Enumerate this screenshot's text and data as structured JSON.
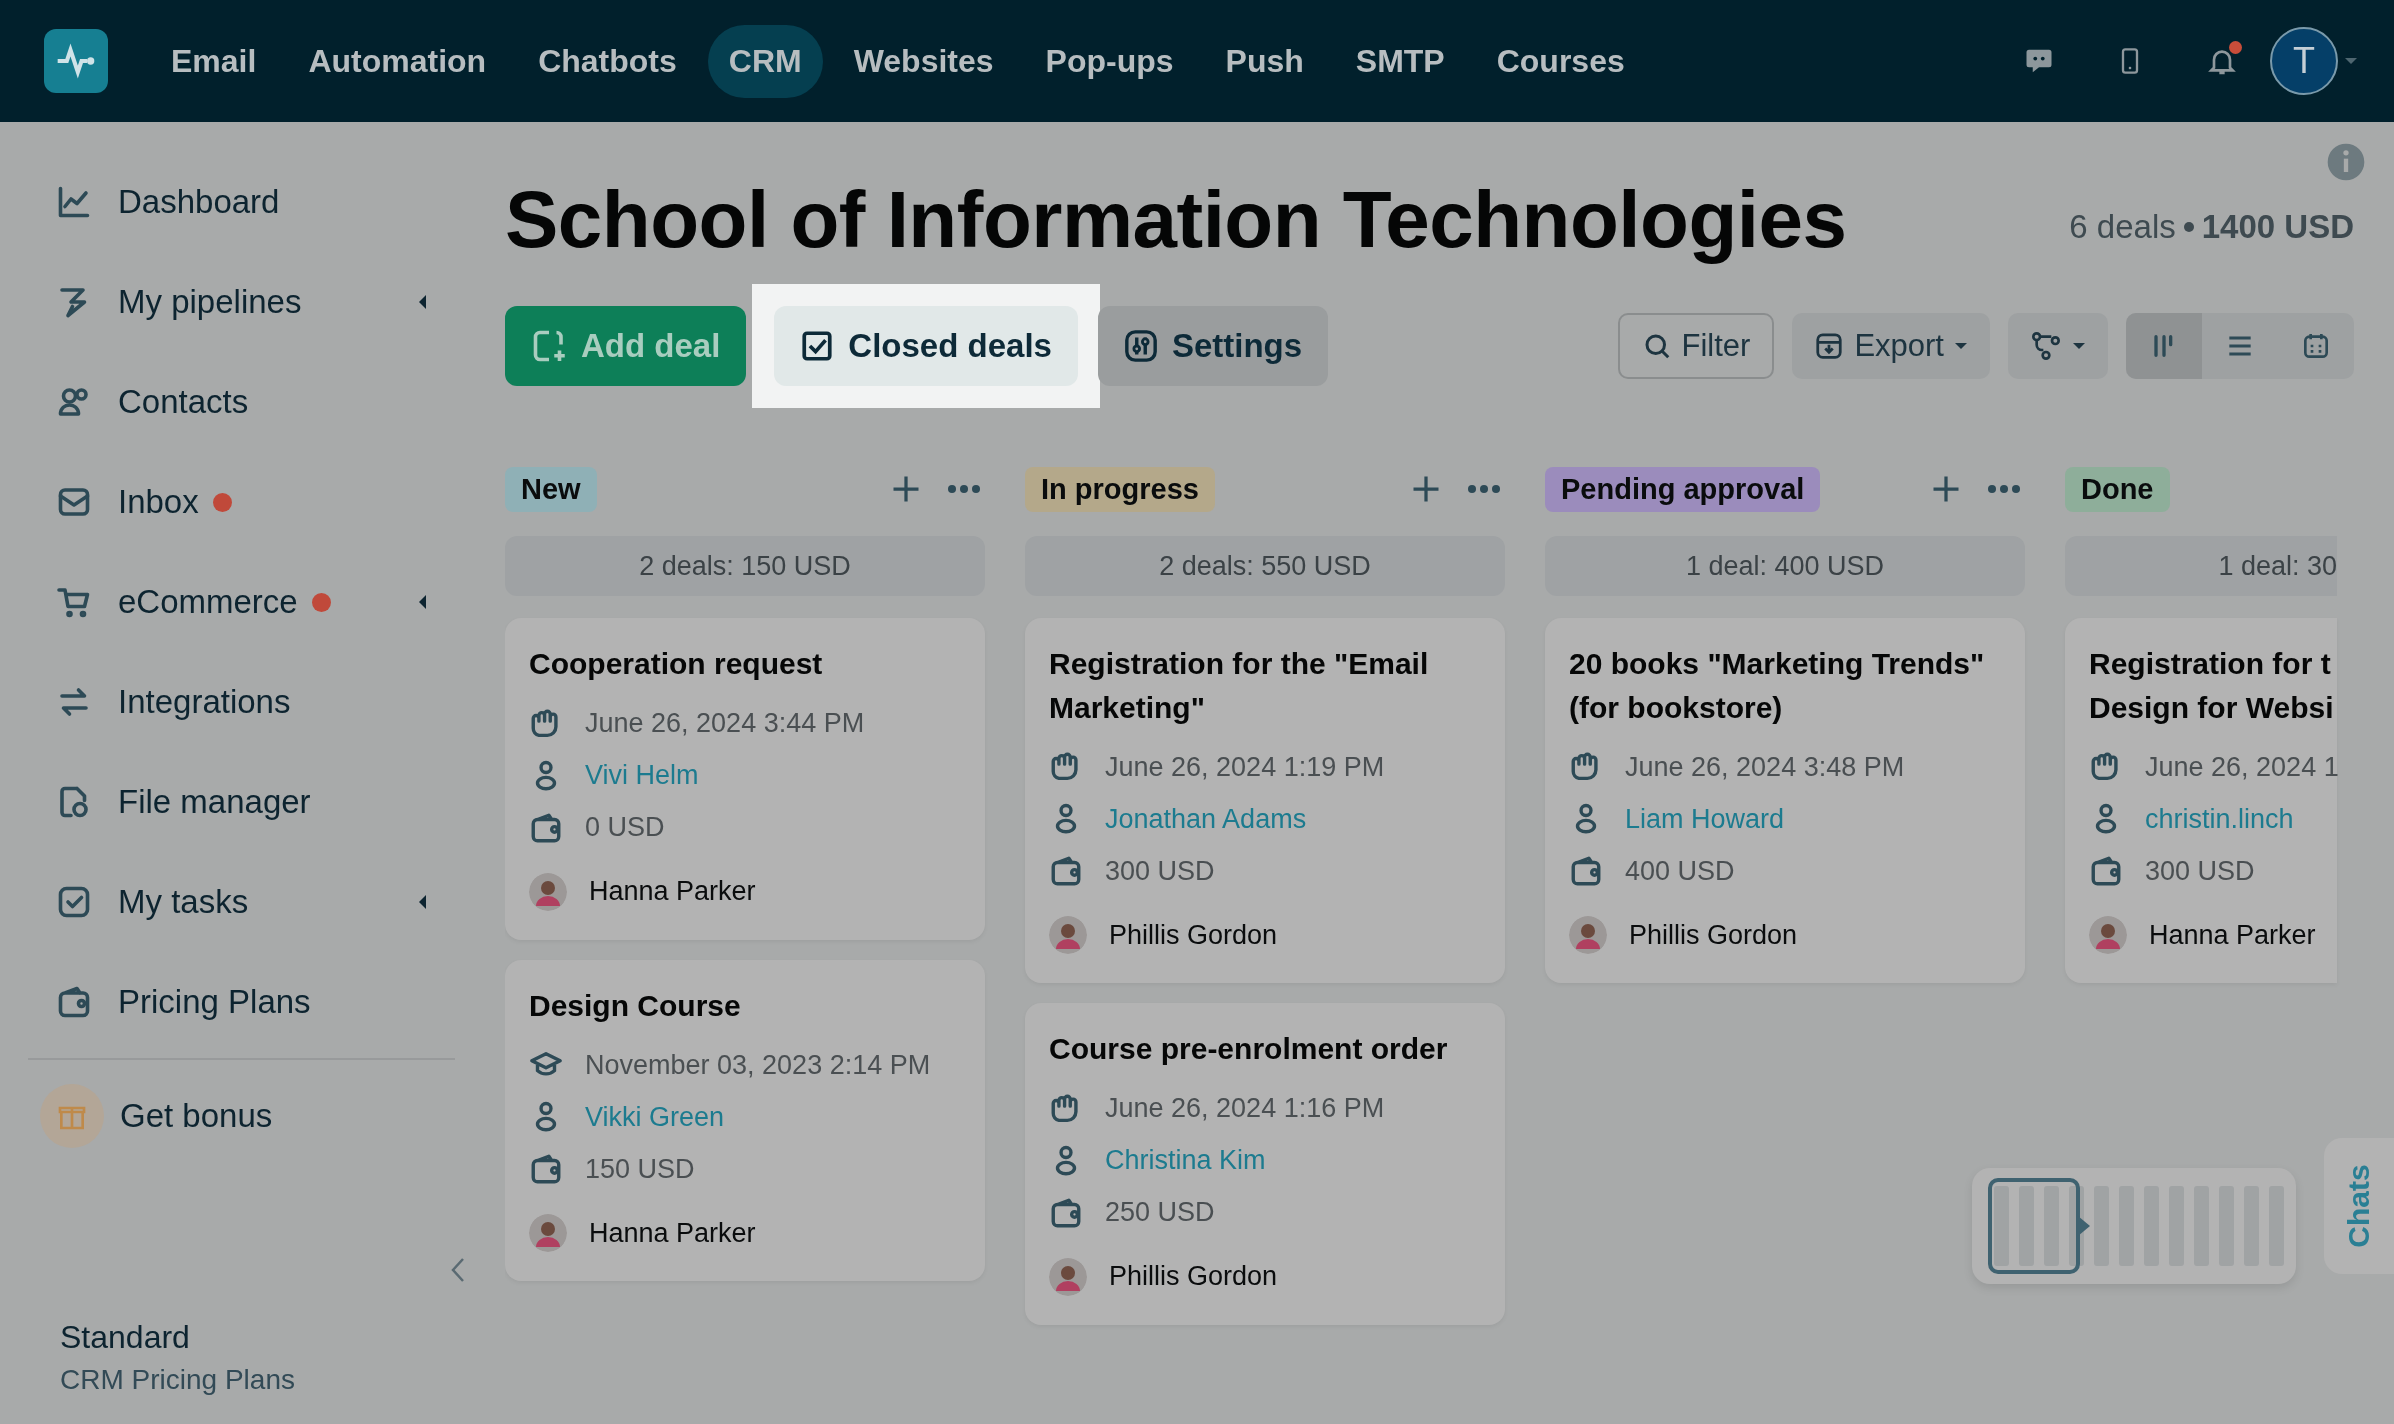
{
  "nav": {
    "items": [
      {
        "label": "Email",
        "selected": false
      },
      {
        "label": "Automation",
        "selected": false
      },
      {
        "label": "Chatbots",
        "selected": false
      },
      {
        "label": "CRM",
        "selected": true
      },
      {
        "label": "Websites",
        "selected": false
      },
      {
        "label": "Pop-ups",
        "selected": false
      },
      {
        "label": "Push",
        "selected": false
      },
      {
        "label": "SMTP",
        "selected": false
      },
      {
        "label": "Courses",
        "selected": false
      }
    ],
    "notifications_unread": true,
    "user_initial": "T"
  },
  "sidebar": {
    "items": [
      {
        "kind": "dashboard",
        "label": "Dashboard",
        "dot": false,
        "expandable": false
      },
      {
        "kind": "pipelines",
        "label": "My pipelines",
        "dot": false,
        "expandable": true
      },
      {
        "kind": "contacts",
        "label": "Contacts",
        "dot": false,
        "expandable": false
      },
      {
        "kind": "inbox",
        "label": "Inbox",
        "dot": true,
        "expandable": false
      },
      {
        "kind": "ecommerce",
        "label": "eCommerce",
        "dot": true,
        "expandable": true
      },
      {
        "kind": "integrations",
        "label": "Integrations",
        "dot": false,
        "expandable": false
      },
      {
        "kind": "files",
        "label": "File manager",
        "dot": false,
        "expandable": false
      },
      {
        "kind": "tasks",
        "label": "My tasks",
        "dot": false,
        "expandable": true
      },
      {
        "kind": "pricing",
        "label": "Pricing Plans",
        "dot": false,
        "expandable": false
      }
    ],
    "bonus": "Get bonus",
    "plan": {
      "name": "Standard",
      "subtitle": "CRM Pricing Plans"
    }
  },
  "header": {
    "title": "School of Information Technologies",
    "deals": "6 deals",
    "total": "1400 USD"
  },
  "toolbar": {
    "add": "Add deal",
    "closed": "Closed deals",
    "closed_highlighted": true,
    "settings": "Settings",
    "filter": "Filter",
    "export": "Export",
    "views": [
      {
        "kind": "board",
        "selected": true
      },
      {
        "kind": "list",
        "selected": false
      },
      {
        "kind": "calendar",
        "selected": false
      }
    ]
  },
  "columns": [
    {
      "name": "New",
      "color": "#8fb0b6",
      "summary": "2 deals: 150 USD",
      "cards": [
        {
          "kind": "form",
          "title": "Cooperation request",
          "date": "June 26, 2024 3:44 PM",
          "contact": "Vivi Helm",
          "amount": "0 USD",
          "manager": "Hanna Parker"
        },
        {
          "kind": "course",
          "title": "Design Course",
          "date": "November 03, 2023 2:14 PM",
          "contact": "Vikki Green",
          "amount": "150 USD",
          "manager": "Hanna Parker"
        }
      ]
    },
    {
      "name": "In progress",
      "color": "#b4a88a",
      "summary": "2 deals: 550 USD",
      "cards": [
        {
          "kind": "form",
          "title": "Registration for the \"Email Marketing\"",
          "date": "June 26, 2024 1:19 PM",
          "contact": "Jonathan Adams",
          "amount": "300 USD",
          "manager": "Phillis Gordon"
        },
        {
          "kind": "form",
          "title": "Course pre-enrolment order",
          "date": "June 26, 2024 1:16 PM",
          "contact": "Christina Kim",
          "amount": "250 USD",
          "manager": "Phillis Gordon"
        }
      ]
    },
    {
      "name": "Pending approval",
      "color": "#9b8cbc",
      "summary": "1 deal: 400 USD",
      "cards": [
        {
          "kind": "form",
          "title": "20 books \"Marketing Trends\" (for bookstore)",
          "date": "June 26, 2024 3:48 PM",
          "contact": "Liam Howard",
          "amount": "400 USD",
          "manager": "Phillis Gordon"
        }
      ]
    },
    {
      "name": "Done",
      "color": "#8eae9a",
      "summary": "1 deal: 30",
      "cards": [
        {
          "kind": "form",
          "title": "Registration for t\nDesign for Websi",
          "date": "June 26, 2024 1",
          "contact": "christin.linch",
          "amount": "300 USD",
          "manager": "Hanna Parker"
        }
      ]
    }
  ],
  "chats_tab": "Chats"
}
